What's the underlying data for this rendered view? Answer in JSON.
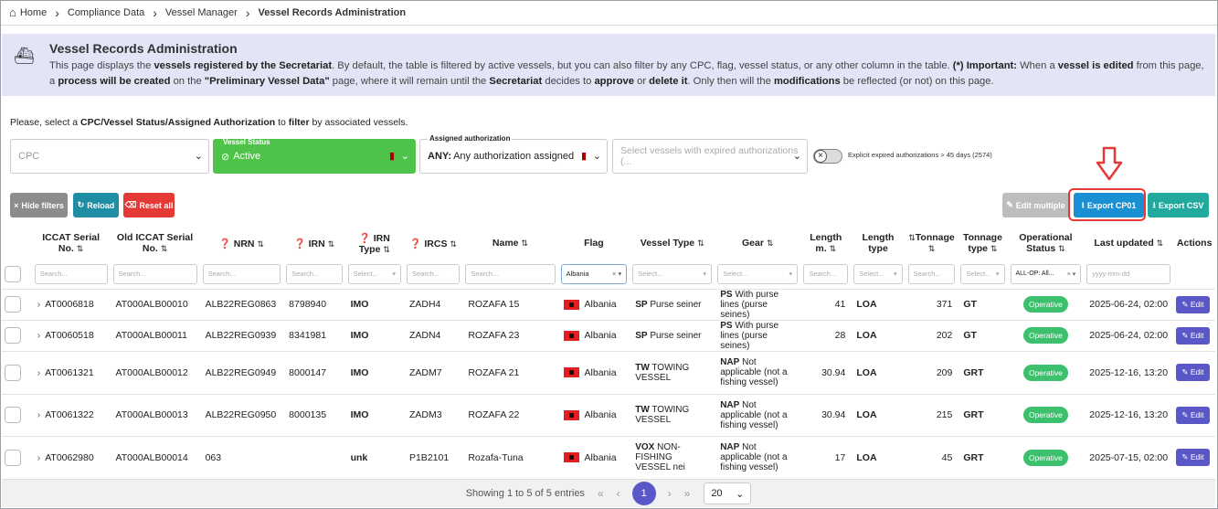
{
  "breadcrumb": {
    "home": "Home",
    "level1": "Compliance Data",
    "level2": "Vessel Manager",
    "current": "Vessel Records Administration"
  },
  "info": {
    "title": "Vessel Records Administration",
    "p1": "This page displays the ",
    "b1": "vessels registered by the Secretariat",
    "p2": ". By default, the table is filtered by active vessels, but you can also filter by any CPC, flag, vessel status, or any other column in the table. ",
    "b2": "(*) Important:",
    "p3": " When a ",
    "b3": "vessel is edited",
    "p4": " from this page, a ",
    "b4": "process will be created",
    "p5": " on the ",
    "b5": "\"Preliminary Vessel Data\"",
    "p6": " page, where it will remain until the ",
    "b6": "Secretariat",
    "p7": " decides to ",
    "b7": "approve",
    "p8": " or ",
    "b8": "delete it",
    "p9": ". Only then will the ",
    "b9": "modifications",
    "p10": " be reflected (or not) on this page."
  },
  "filter_intro": {
    "a": "Please, select a ",
    "b": "CPC/Vessel Status/Assigned Authorization",
    "c": " to ",
    "d": "filter",
    "e": " by associated vessels."
  },
  "filters": {
    "cpc_placeholder": "CPC",
    "status_legend": "Vessel Status",
    "status_value": "Active",
    "auth_legend": "Assigned authorization",
    "auth_value_bold": "ANY:",
    "auth_value": " Any authorization assigned",
    "expired_placeholder": "Select vessels with expired authorizations (...",
    "toggle_label": "Explicit expired authorizations > 45 days (2574)"
  },
  "toolbar": {
    "hide_filters": "Hide filters",
    "reload": "Reload",
    "reset_all": "Reset all",
    "edit_multiple": "Edit multiple",
    "export_cp01": "Export CP01",
    "export_csv": "Export CSV"
  },
  "columns": {
    "iccat": "ICCAT Serial No.",
    "old_iccat": "Old ICCAT Serial No.",
    "nrn": "NRN",
    "irn": "IRN",
    "irn_type": "IRN Type",
    "ircs": "IRCS",
    "name": "Name",
    "flag": "Flag",
    "vessel_type": "Vessel Type",
    "gear": "Gear",
    "length": "Length m.",
    "length_type": "Length type",
    "tonnage": "Tonnage",
    "tonnage_type": "Tonnage type",
    "op_status": "Operational Status",
    "last_updated": "Last updated",
    "actions": "Actions"
  },
  "column_filters": {
    "search": "Search...",
    "select": "Select...",
    "flag": "Albania",
    "op_status": "ALL-OP: All...",
    "date": "yyyy-mm-dd"
  },
  "rows": [
    {
      "iccat": "AT0006818",
      "old": "AT000ALB00010",
      "nrn": "ALB22REG0863",
      "irn": "8798940",
      "irn_type": "IMO",
      "ircs": "ZADH4",
      "name": "ROZAFA 15",
      "flag": "Albania",
      "vt_code": "SP",
      "vt_name": "Purse seiner",
      "gear_code": "PS",
      "gear_name": "With purse lines (purse seines)",
      "length": "41",
      "length_type": "LOA",
      "tonnage": "371",
      "tonnage_type": "GT",
      "status": "Operative",
      "updated": "2025-06-24, 02:00",
      "action": "Edit"
    },
    {
      "iccat": "AT0060518",
      "old": "AT000ALB00011",
      "nrn": "ALB22REG0939",
      "irn": "8341981",
      "irn_type": "IMO",
      "ircs": "ZADN4",
      "name": "ROZAFA 23",
      "flag": "Albania",
      "vt_code": "SP",
      "vt_name": "Purse seiner",
      "gear_code": "PS",
      "gear_name": "With purse lines (purse seines)",
      "length": "28",
      "length_type": "LOA",
      "tonnage": "202",
      "tonnage_type": "GT",
      "status": "Operative",
      "updated": "2025-06-24, 02:00",
      "action": "Edit"
    },
    {
      "iccat": "AT0061321",
      "old": "AT000ALB00012",
      "nrn": "ALB22REG0949",
      "irn": "8000147",
      "irn_type": "IMO",
      "ircs": "ZADM7",
      "name": "ROZAFA 21",
      "flag": "Albania",
      "vt_code": "TW",
      "vt_name": "TOWING VESSEL",
      "gear_code": "NAP",
      "gear_name": "Not applicable (not a fishing vessel)",
      "length": "30.94",
      "length_type": "LOA",
      "tonnage": "209",
      "tonnage_type": "GRT",
      "status": "Operative",
      "updated": "2025-12-16, 13:20",
      "action": "Edit"
    },
    {
      "iccat": "AT0061322",
      "old": "AT000ALB00013",
      "nrn": "ALB22REG0950",
      "irn": "8000135",
      "irn_type": "IMO",
      "ircs": "ZADM3",
      "name": "ROZAFA 22",
      "flag": "Albania",
      "vt_code": "TW",
      "vt_name": "TOWING VESSEL",
      "gear_code": "NAP",
      "gear_name": "Not applicable (not a fishing vessel)",
      "length": "30.94",
      "length_type": "LOA",
      "tonnage": "215",
      "tonnage_type": "GRT",
      "status": "Operative",
      "updated": "2025-12-16, 13:20",
      "action": "Edit"
    },
    {
      "iccat": "AT0062980",
      "old": "AT000ALB00014",
      "nrn": "063",
      "irn": "",
      "irn_type": "unk",
      "ircs": "P1B2101",
      "name": "Rozafa-Tuna",
      "flag": "Albania",
      "vt_code": "VOX",
      "vt_name": "NON-FISHING VESSEL nei",
      "gear_code": "NAP",
      "gear_name": "Not applicable (not a fishing vessel)",
      "length": "17",
      "length_type": "LOA",
      "tonnage": "45",
      "tonnage_type": "GRT",
      "status": "Operative",
      "updated": "2025-07-15, 02:00",
      "action": "Edit"
    }
  ],
  "pagination": {
    "summary": "Showing 1 to 5 of 5 entries",
    "current": "1",
    "per_page": "20"
  },
  "colors": {
    "accent": "#5a58c8",
    "active_green": "#4fc24a",
    "operative": "#3cc06d",
    "export_blue": "#1a8fd1",
    "export_csv": "#21a99d",
    "reset": "#e53935",
    "reload": "#1f8ea5",
    "hide": "#8c8c8c",
    "highlight": "#e53935"
  }
}
